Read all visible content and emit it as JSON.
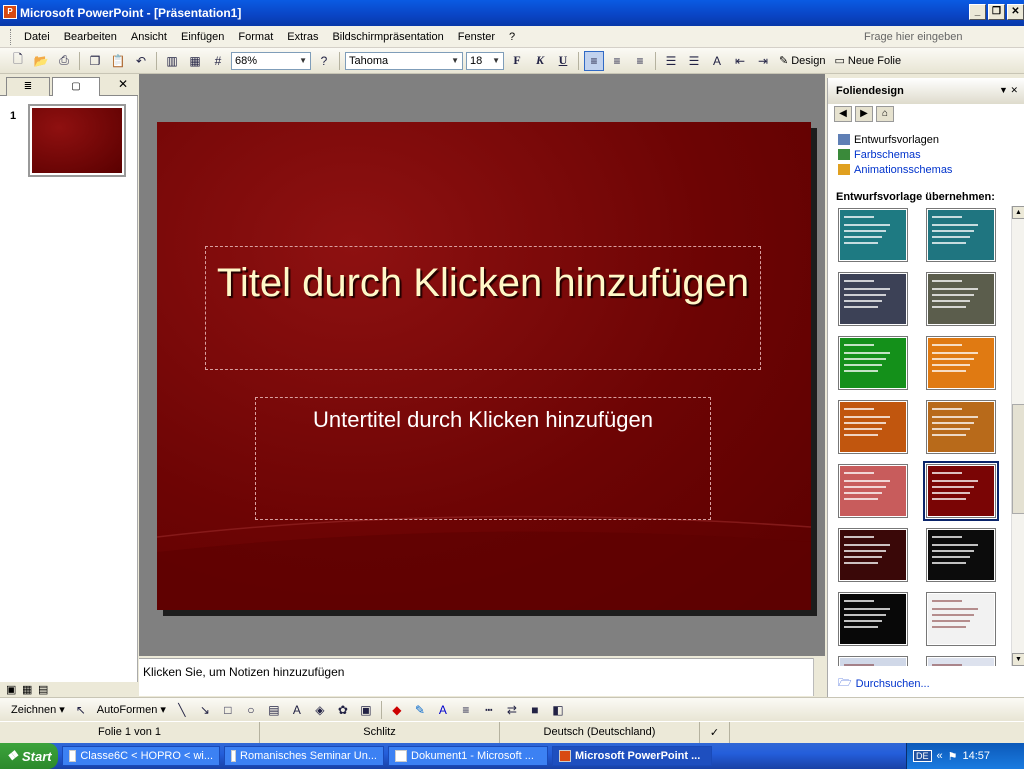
{
  "app": {
    "title": "Microsoft PowerPoint - [Präsentation1]"
  },
  "window_buttons": {
    "minimize": "_",
    "restore": "❐",
    "close": "✕"
  },
  "menu": {
    "items": [
      "Datei",
      "Bearbeiten",
      "Ansicht",
      "Einfügen",
      "Format",
      "Extras",
      "Bildschirmpräsentation",
      "Fenster",
      "?"
    ],
    "help_placeholder": "Frage hier eingeben"
  },
  "toolbar": {
    "zoom": "68%",
    "font_name": "Tahoma",
    "font_size": "18",
    "bold": "F",
    "italic": "K",
    "underline": "U",
    "design_label": "Design",
    "new_slide_label": "Neue Folie"
  },
  "slides_pane": {
    "slide_number": "1"
  },
  "slide": {
    "title_placeholder": "Titel durch Klicken hinzufügen",
    "subtitle_placeholder": "Untertitel durch Klicken hinzufügen",
    "colors": {
      "background": "#7a0606",
      "title_text": "#fff8c8"
    }
  },
  "notes": {
    "placeholder": "Klicken Sie, um Notizen hinzuzufügen"
  },
  "task_pane": {
    "title": "Foliendesign",
    "links": [
      "Entwurfsvorlagen",
      "Farbschemas",
      "Animationsschemas"
    ],
    "section_title": "Entwurfsvorlage übernehmen:",
    "templates": [
      {
        "color": "#1e7a82",
        "selected": false
      },
      {
        "color": "#1f7580",
        "selected": false
      },
      {
        "color": "#3c4156",
        "selected": false
      },
      {
        "color": "#5b5d4c",
        "selected": false
      },
      {
        "color": "#14901a",
        "selected": false
      },
      {
        "color": "#e07a12",
        "selected": false
      },
      {
        "color": "#c1560e",
        "selected": false
      },
      {
        "color": "#b86a1a",
        "selected": false
      },
      {
        "color": "#c85c5c",
        "selected": false
      },
      {
        "color": "#7a0505",
        "selected": true
      },
      {
        "color": "#3a0808",
        "selected": false
      },
      {
        "color": "#0c0c0c",
        "selected": false
      },
      {
        "color": "#080808",
        "selected": false
      },
      {
        "color": "#f2f2f2",
        "selected": false
      },
      {
        "color": "#d0d8e8",
        "selected": false
      },
      {
        "color": "#dde2ee",
        "selected": false
      }
    ],
    "browse_label": "Durchsuchen..."
  },
  "drawing_toolbar": {
    "draw_label": "Zeichnen",
    "autoshapes_label": "AutoFormen"
  },
  "status": {
    "slide_info": "Folie 1 von 1",
    "design": "Schlitz",
    "language": "Deutsch (Deutschland)"
  },
  "taskbar": {
    "start": "Start",
    "tasks": [
      {
        "label": "Classe6C < HOPRO < wi...",
        "active": false
      },
      {
        "label": "Romanisches Seminar Un...",
        "active": false
      },
      {
        "label": "Dokument1 - Microsoft ...",
        "active": false
      },
      {
        "label": "Microsoft PowerPoint ...",
        "active": true
      }
    ],
    "lang": "DE",
    "time": "14:57"
  }
}
